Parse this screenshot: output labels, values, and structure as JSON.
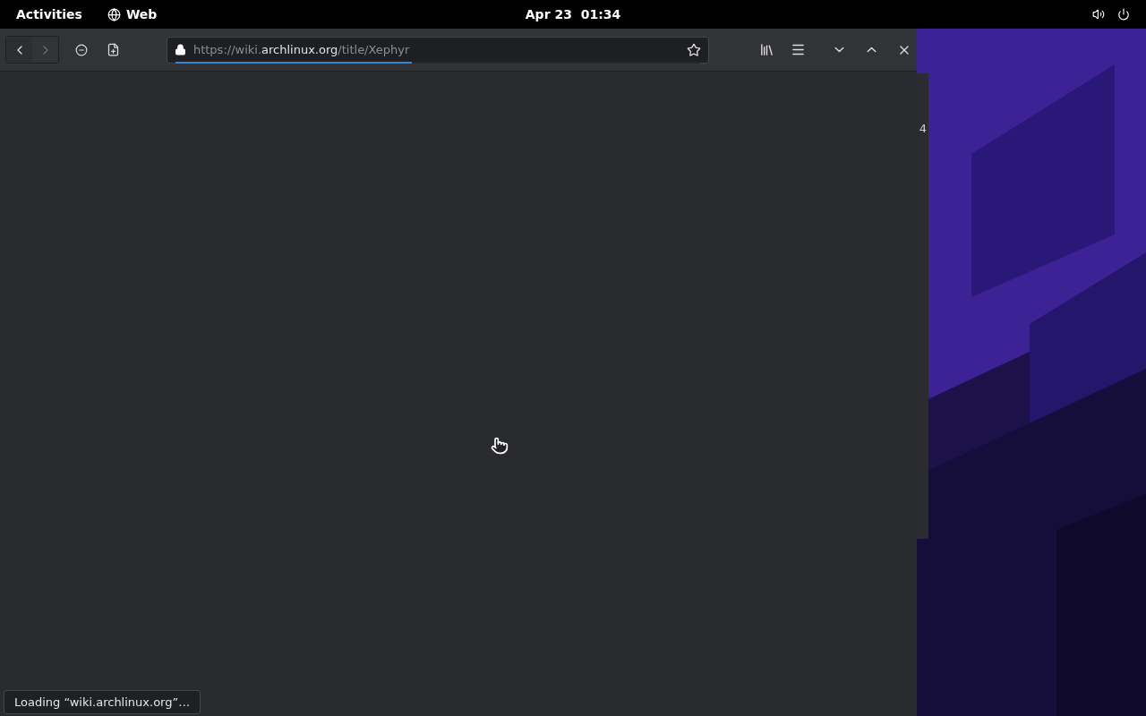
{
  "top_bar": {
    "activities": "Activities",
    "app_name": "Web",
    "clock": "Apr 23  01:34"
  },
  "browser": {
    "back_disabled": false,
    "forward_disabled": true,
    "url": {
      "prefix": "https://wiki.",
      "domain": "archlinux.org",
      "path": "/title/Xephyr"
    },
    "loading": true,
    "progress": {
      "level": 0.45
    },
    "status": "Loading “wiki.archlinux.org”…"
  },
  "background_window": {
    "fragment": "4"
  }
}
